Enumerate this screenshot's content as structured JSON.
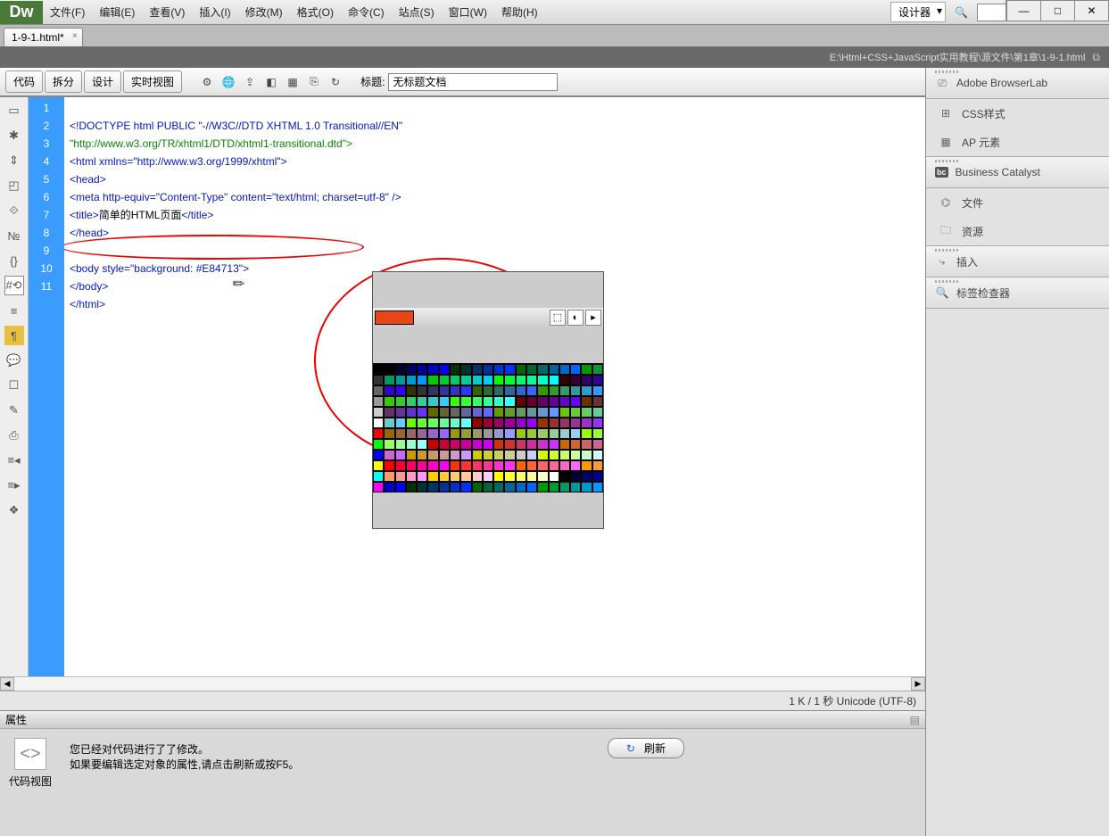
{
  "menubar": {
    "items": [
      "文件(F)",
      "编辑(E)",
      "查看(V)",
      "插入(I)",
      "修改(M)",
      "格式(O)",
      "命令(C)",
      "站点(S)",
      "窗口(W)",
      "帮助(H)"
    ],
    "designer": "设计器"
  },
  "win": {
    "min": "—",
    "max": "□",
    "close": "✕"
  },
  "tab": {
    "name": "1-9-1.html*",
    "close": "×"
  },
  "pathbar": {
    "text": "E:\\Html+CSS+JavaScript实用教程\\源文件\\第1章\\1-9-1.html"
  },
  "toolbar": {
    "btns": [
      "代码",
      "拆分",
      "设计",
      "实时视图"
    ],
    "title_lbl": "标题:",
    "title_val": "无标题文档"
  },
  "code": {
    "lines": [
      "1",
      "2",
      "3",
      "4",
      "5",
      "6",
      "7",
      "8",
      "9",
      "10",
      "11"
    ],
    "l1": "<!DOCTYPE html PUBLIC \"-//W3C//DTD XHTML 1.0 Transitional//EN\"",
    "l1b": "\"http://www.w3.org/TR/xhtml1/DTD/xhtml1-transitional.dtd\">",
    "l2": "<html xmlns=\"http://www.w3.org/1999/xhtml\">",
    "l3": "<head>",
    "l4": "<meta http-equiv=\"Content-Type\" content=\"text/html; charset=utf-8\" />",
    "l5a": "<title>",
    "l5b": "简单的HTML页面",
    "l5c": "</title>",
    "l6": "</head>",
    "l8a": "<body style=\"background:",
    "l8b": " #E84713",
    "l8c": "\">",
    "l9": "</body>",
    "l10": "</html>"
  },
  "picker": {
    "current": "#E84713",
    "icons": [
      "⬚",
      "◐",
      "▸"
    ]
  },
  "status": {
    "text": "1 K / 1 秒 Unicode (UTF-8)"
  },
  "props": {
    "head": "属性",
    "codeview": "代码视图",
    "msg1": "您已经对代码进行了了修改。",
    "msg2": "如果要编辑选定对象的属性,请点击刷新或按F5。",
    "refresh": "刷新"
  },
  "panels": {
    "p1": "Adobe BrowserLab",
    "p2": [
      "CSS样式",
      "AP 元素"
    ],
    "p3": "Business Catalyst",
    "p4": [
      "文件",
      "资源"
    ],
    "p5": "插入",
    "p6": "标签检查器"
  }
}
